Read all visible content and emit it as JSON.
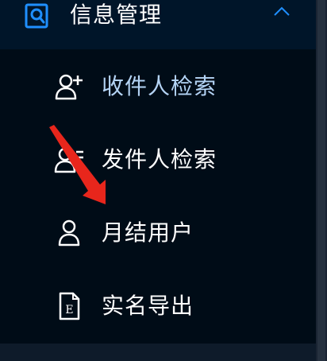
{
  "menu": {
    "title": "信息管理",
    "icon": "search-doc-icon",
    "expanded_icon": "chevron-up-icon",
    "items": [
      {
        "label": "收件人检索",
        "icon": "add-user-icon",
        "active": true
      },
      {
        "label": "发件人检索",
        "icon": "user-list-icon",
        "active": false
      },
      {
        "label": "月结用户",
        "icon": "user-icon",
        "active": false
      },
      {
        "label": "实名导出",
        "icon": "export-file-icon",
        "active": false
      }
    ]
  },
  "annotation": {
    "icon": "red-arrow-icon",
    "color": "#e8261c"
  },
  "colors": {
    "header_bg": "#001529",
    "submenu_bg": "#000c17",
    "active_text": "#b4d4f5",
    "accent": "#1f8fff",
    "text": "#ffffff"
  }
}
